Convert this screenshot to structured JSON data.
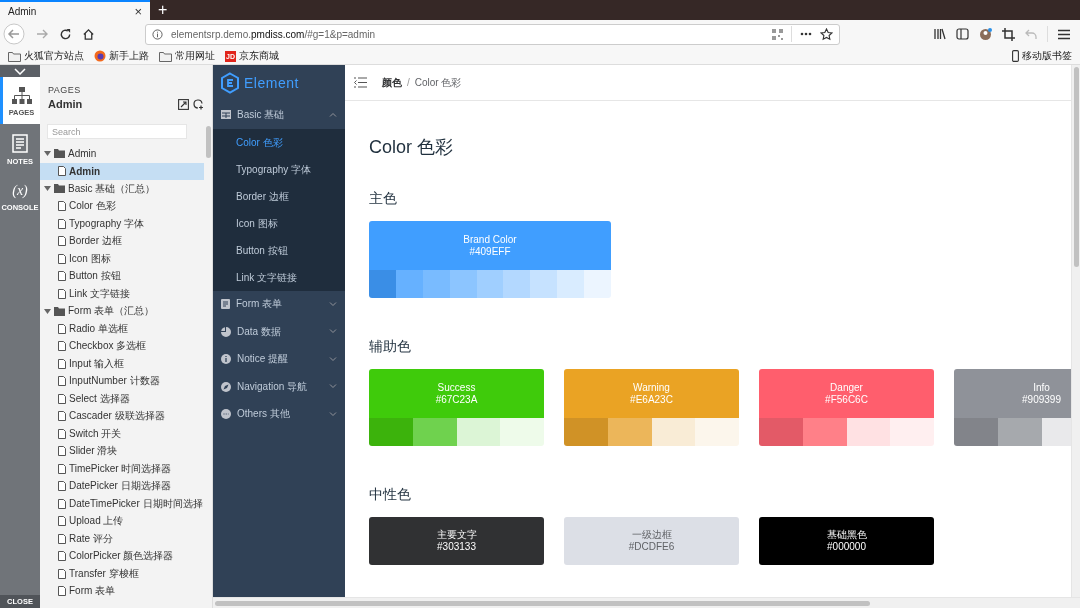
{
  "browser": {
    "tab": {
      "title": "Admin",
      "close": "×",
      "selected": true
    },
    "new_tab": "+",
    "url": {
      "prefix": "elementsrp.demo.",
      "domain": "pmdiss.com",
      "path": "/#g=1&p=admin"
    },
    "bookmarks": [
      {
        "kind": "folder",
        "label": "火狐官方站点"
      },
      {
        "kind": "firefox",
        "label": "新手上路"
      },
      {
        "kind": "folder",
        "label": "常用网址"
      },
      {
        "kind": "jd",
        "label": "京东商城",
        "badge": "JD"
      }
    ],
    "mobile_bookmarks": "移动版书签"
  },
  "rail": {
    "items": [
      {
        "kind": "pages",
        "label": "PAGES",
        "selected": true
      },
      {
        "kind": "notes",
        "label": "NOTES",
        "selected": false
      },
      {
        "kind": "console",
        "label": "CONSOLE",
        "glyph": "(x)",
        "selected": false
      }
    ],
    "close": "CLOSE"
  },
  "pages_panel": {
    "heading": "PAGES",
    "title": "Admin",
    "search": {
      "placeholder": "Search"
    },
    "tree": [
      {
        "kind": "folder",
        "label": "Admin",
        "expanded": true,
        "selected": false,
        "children": [
          {
            "kind": "page",
            "label": "Admin",
            "selected": true
          }
        ]
      },
      {
        "kind": "folder",
        "label": "Basic 基础（汇总）",
        "expanded": true,
        "selected": false,
        "children": [
          {
            "kind": "page",
            "label": "Color 色彩",
            "selected": false
          },
          {
            "kind": "page",
            "label": "Typography 字体",
            "selected": false
          },
          {
            "kind": "page",
            "label": "Border 边框",
            "selected": false
          },
          {
            "kind": "page",
            "label": "Icon 图标",
            "selected": false
          },
          {
            "kind": "page",
            "label": "Button 按钮",
            "selected": false
          },
          {
            "kind": "page",
            "label": "Link 文字链接",
            "selected": false
          }
        ]
      },
      {
        "kind": "folder",
        "label": "Form 表单（汇总）",
        "expanded": true,
        "selected": false,
        "children": [
          {
            "kind": "page",
            "label": "Radio 单选框",
            "selected": false
          },
          {
            "kind": "page",
            "label": "Checkbox 多选框",
            "selected": false
          },
          {
            "kind": "page",
            "label": "Input 输入框",
            "selected": false
          },
          {
            "kind": "page",
            "label": "InputNumber 计数器",
            "selected": false
          },
          {
            "kind": "page",
            "label": "Select 选择器",
            "selected": false
          },
          {
            "kind": "page",
            "label": "Cascader 级联选择器",
            "selected": false
          },
          {
            "kind": "page",
            "label": "Switch 开关",
            "selected": false
          },
          {
            "kind": "page",
            "label": "Slider 滑块",
            "selected": false
          },
          {
            "kind": "page",
            "label": "TimePicker 时间选择器",
            "selected": false
          },
          {
            "kind": "page",
            "label": "DatePicker 日期选择器",
            "selected": false
          },
          {
            "kind": "page",
            "label": "DateTimePicker 日期时间选择",
            "selected": false
          },
          {
            "kind": "page",
            "label": "Upload 上传",
            "selected": false
          },
          {
            "kind": "page",
            "label": "Rate 评分",
            "selected": false
          },
          {
            "kind": "page",
            "label": "ColorPicker 颜色选择器",
            "selected": false
          },
          {
            "kind": "page",
            "label": "Transfer 穿梭框",
            "selected": false
          },
          {
            "kind": "page",
            "label": "Form 表单",
            "selected": false
          }
        ]
      }
    ]
  },
  "app_sidebar": {
    "logo": "Element",
    "menu": [
      {
        "kind": "grid",
        "label": "Basic 基础",
        "expanded": true,
        "children": [
          {
            "label": "Color 色彩",
            "selected": true
          },
          {
            "label": "Typography 字体",
            "selected": false
          },
          {
            "label": "Border 边框",
            "selected": false
          },
          {
            "label": "Icon 图标",
            "selected": false
          },
          {
            "label": "Button 按钮",
            "selected": false
          },
          {
            "label": "Link 文字链接",
            "selected": false
          }
        ]
      },
      {
        "kind": "doc",
        "label": "Form 表单",
        "expanded": false
      },
      {
        "kind": "pie",
        "label": "Data 数据",
        "expanded": false
      },
      {
        "kind": "info",
        "label": "Notice 提醒",
        "expanded": false
      },
      {
        "kind": "compass",
        "label": "Navigation 导航",
        "expanded": false
      },
      {
        "kind": "more",
        "label": "Others 其他",
        "expanded": false
      }
    ]
  },
  "breadcrumb": {
    "items": [
      "颜色",
      "Color 色彩"
    ],
    "separator": "/"
  },
  "page": {
    "title": "Color 色彩",
    "sections": [
      {
        "heading": "主色",
        "swatches": [
          {
            "name": "Brand Color",
            "hex": "#409EFF",
            "color": "#409eff",
            "shades": [
              {
                "color": "#3a8ee6"
              },
              {
                "color": "#66b1ff"
              },
              {
                "color": "#79bbff"
              },
              {
                "color": "#8cc5ff"
              },
              {
                "color": "#a0cfff"
              },
              {
                "color": "#b3d8ff"
              },
              {
                "color": "#c6e2ff"
              },
              {
                "color": "#d9ecff"
              },
              {
                "color": "#ecf5ff"
              }
            ]
          }
        ]
      },
      {
        "heading": "辅助色",
        "swatches": [
          {
            "name": "Success",
            "hex": "#67C23A",
            "color": "#3fcb0b",
            "shades": [
              {
                "color": "#3cb30c"
              },
              {
                "color": "#6fd24e"
              },
              {
                "color": "#dcf5d6"
              },
              {
                "color": "#eefbea"
              }
            ]
          },
          {
            "name": "Warning",
            "hex": "#E6A23C",
            "color": "#eaa324",
            "shades": [
              {
                "color": "#d09226"
              },
              {
                "color": "#ecb65a"
              },
              {
                "color": "#f9ecd6"
              },
              {
                "color": "#fcf6ec"
              }
            ]
          },
          {
            "name": "Danger",
            "hex": "#F56C6C",
            "color": "#ff5e6d",
            "shades": [
              {
                "color": "#e35a67"
              },
              {
                "color": "#ff8088"
              },
              {
                "color": "#ffe1e3"
              },
              {
                "color": "#ffeff0"
              }
            ]
          },
          {
            "name": "Info",
            "hex": "#909399",
            "color": "#8f9299",
            "shades": [
              {
                "color": "#82848a"
              },
              {
                "color": "#a6a9ad"
              },
              {
                "color": "#e9e9eb"
              }
            ]
          }
        ]
      },
      {
        "heading": "中性色",
        "swatches": [
          {
            "name": "主要文字",
            "hex": "#303133",
            "color": "#303133"
          },
          {
            "name": "一级边框",
            "hex": "#DCDFE6",
            "color": "#dcdfe6"
          },
          {
            "name": "基础黑色",
            "hex": "#000000",
            "color": "#000000"
          }
        ]
      }
    ]
  }
}
